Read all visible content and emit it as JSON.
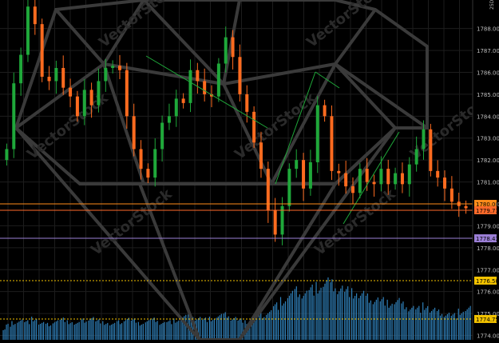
{
  "chart_data": {
    "type": "candlestick",
    "price_axis": {
      "min": 1773.8,
      "max": 1789.3,
      "tick_labels": [
        "1774.00",
        "1775.00",
        "1776.00",
        "1777.00",
        "1778.00",
        "1779.00",
        "1780.00",
        "1781.00",
        "1782.00",
        "1783.00",
        "1784.00",
        "1785.00",
        "1786.00",
        "1787.00",
        "1788.00"
      ],
      "grid": true
    },
    "horizontal_levels": [
      {
        "price": 1780.0,
        "label": "1780.00",
        "color": "#ff8c1a"
      },
      {
        "price": 1779.71,
        "label": "1779.71",
        "color": "#ff6a2a"
      },
      {
        "price": 1778.43,
        "label": "1778.43",
        "color": "#9b7fd6"
      },
      {
        "price": 1776.5,
        "label": "1776.50",
        "color": "#f2c200"
      },
      {
        "price": 1774.75,
        "label": "1774.75",
        "color": "#f2c200"
      }
    ],
    "closes": [
      1782.5,
      1785.5,
      1786.8,
      1789.0,
      1788.2,
      1785.8,
      1785.6,
      1786.2,
      1785.3,
      1784.9,
      1784.0,
      1785.2,
      1784.5,
      1785.6,
      1786.2,
      1786.3,
      1786.1,
      1784.0,
      1782.5,
      1781.6,
      1781.2,
      1782.5,
      1783.7,
      1784.0,
      1784.8,
      1784.6,
      1786.1,
      1785.6,
      1785.0,
      1784.9,
      1786.4,
      1787.6,
      1786.7,
      1785.0,
      1784.2,
      1782.8,
      1781.6,
      1779.7,
      1778.6,
      1779.9,
      1781.6,
      1782.0,
      1780.7,
      1781.9,
      1784.5,
      1784.0,
      1781.5,
      1781.4,
      1780.8,
      1780.5,
      1781.6,
      1781.0,
      1780.9,
      1781.6,
      1780.9,
      1781.4,
      1780.9,
      1781.8,
      1782.5,
      1783.4,
      1781.5,
      1781.2,
      1780.7,
      1780.1,
      1779.9,
      1779.8
    ],
    "volume": [
      18,
      21,
      24,
      22,
      26,
      20,
      19,
      23,
      25,
      22,
      20,
      24,
      27,
      23,
      21,
      19,
      22,
      26,
      24,
      20,
      23,
      25,
      21,
      22,
      24,
      28,
      30,
      27,
      25,
      26,
      29,
      31,
      27,
      24,
      22,
      26,
      30,
      35,
      42,
      48,
      55,
      60,
      58,
      62,
      65,
      70,
      68,
      64,
      60,
      58,
      55,
      52,
      50,
      48,
      45,
      47,
      43,
      40,
      38,
      42,
      36,
      34,
      32,
      30,
      35,
      38
    ],
    "overlay": {
      "type": "polyline-mesh",
      "color": "#3a3a3a"
    },
    "watermark": "VectorStock",
    "vertical_label": "25D"
  }
}
